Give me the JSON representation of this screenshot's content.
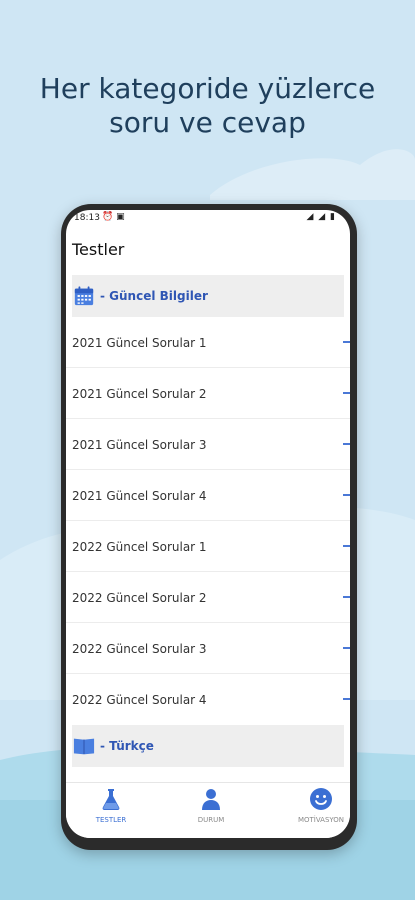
{
  "headline": {
    "line1": "Her kategoride yüzlerce",
    "line2": "soru ve cevap"
  },
  "status_bar": {
    "time": "18:13",
    "left_icons": "⏰ ▣",
    "right_icons": "◢ ◢ ▮"
  },
  "app": {
    "title": "Testler",
    "sections": [
      {
        "label": "- Güncel Bilgiler",
        "icon": "calendar-icon",
        "items": [
          "2021 Güncel Sorular 1",
          "2021 Güncel Sorular 2",
          "2021 Güncel Sorular 3",
          "2021 Güncel Sorular 4",
          "2022 Güncel Sorular 1",
          "2022 Güncel Sorular 2",
          "2022 Güncel Sorular 3",
          "2022 Güncel Sorular 4"
        ]
      },
      {
        "label": "- Türkçe",
        "icon": "book-icon",
        "items": []
      }
    ]
  },
  "bottom_nav": [
    {
      "label": "TESTLER",
      "icon": "flask-icon",
      "active": true
    },
    {
      "label": "DURUM",
      "icon": "person-icon",
      "active": false
    },
    {
      "label": "MOTİVASYON",
      "icon": "smiley-icon",
      "active": false
    }
  ],
  "colors": {
    "accent": "#3b6fd3",
    "section_label": "#2f56b4",
    "background": "#cfe6f4",
    "headline": "#1f3f5c"
  }
}
